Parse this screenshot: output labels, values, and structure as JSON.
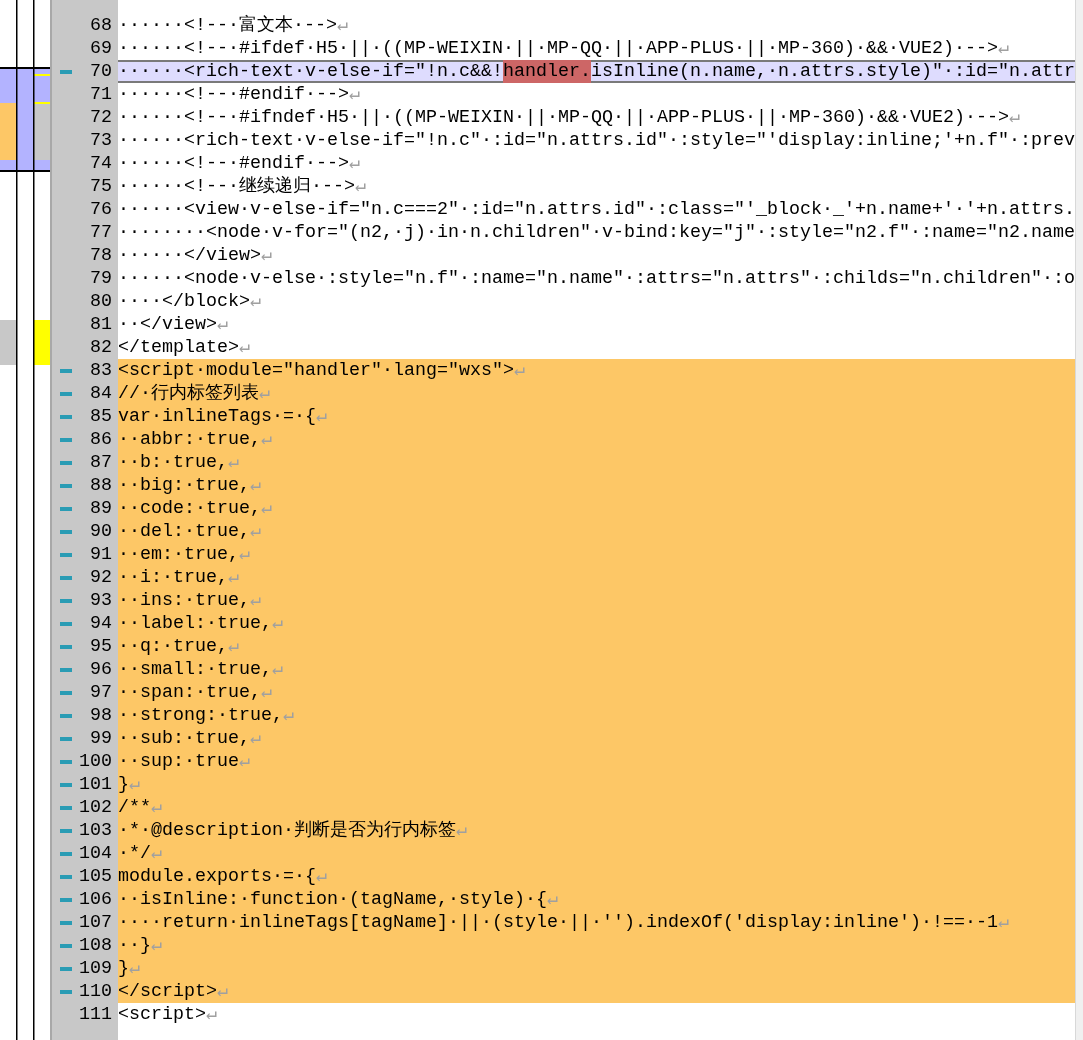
{
  "editor": {
    "lines": [
      {
        "number": "68",
        "text": "······<!--·富文本·-->",
        "eol": "↵",
        "changed": false,
        "current": false
      },
      {
        "number": "69",
        "text": "······<!--·#ifdef·H5·||·((MP-WEIXIN·||·MP-QQ·||·APP-PLUS·||·MP-360)·&&·VUE2)·-->",
        "eol": "↵",
        "changed": false,
        "current": false
      },
      {
        "number": "70",
        "segments": [
          {
            "text": "······<rich-text·v-else-if=\"!n.c&&!",
            "marked": false
          },
          {
            "text": "handler.",
            "marked": true
          },
          {
            "text": "isInline(n.name,·n.attrs.style)\"·:id=\"n.attr",
            "marked": false
          }
        ],
        "changed": true,
        "current": true
      },
      {
        "number": "71",
        "text": "······<!--·#endif·-->",
        "eol": "↵",
        "changed": false,
        "current": false
      },
      {
        "number": "72",
        "text": "······<!--·#ifndef·H5·||·((MP-WEIXIN·||·MP-QQ·||·APP-PLUS·||·MP-360)·&&·VUE2)·-->",
        "eol": "↵",
        "changed": false,
        "current": false
      },
      {
        "number": "73",
        "text": "······<rich-text·v-else-if=\"!n.c\"·:id=\"n.attrs.id\"·:style=\"'display:inline;'+n.f\"·:prev",
        "changed": false,
        "current": false
      },
      {
        "number": "74",
        "text": "······<!--·#endif·-->",
        "eol": "↵",
        "changed": false,
        "current": false
      },
      {
        "number": "75",
        "text": "······<!--·继续递归·-->",
        "eol": "↵",
        "changed": false,
        "current": false
      },
      {
        "number": "76",
        "text": "······<view·v-else-if=\"n.c===2\"·:id=\"n.attrs.id\"·:class=\"'_block·_'+n.name+'·'+n.attrs.",
        "changed": false,
        "current": false
      },
      {
        "number": "77",
        "text": "········<node·v-for=\"(n2,·j)·in·n.children\"·v-bind:key=\"j\"·:style=\"n2.f\"·:name=\"n2.name",
        "changed": false,
        "current": false
      },
      {
        "number": "78",
        "text": "······</view>",
        "eol": "↵",
        "changed": false,
        "current": false
      },
      {
        "number": "79",
        "text": "······<node·v-else·:style=\"n.f\"·:name=\"n.name\"·:attrs=\"n.attrs\"·:childs=\"n.children\"·:o",
        "changed": false,
        "current": false
      },
      {
        "number": "80",
        "text": "····</block>",
        "eol": "↵",
        "changed": false,
        "current": false
      },
      {
        "number": "81",
        "text": "··</view>",
        "eol": "↵",
        "changed": false,
        "current": false
      },
      {
        "number": "82",
        "text": "</template>",
        "eol": "↵",
        "changed": false,
        "current": false
      },
      {
        "number": "83",
        "text": "<script·module=\"handler\"·lang=\"wxs\">",
        "eol": "↵",
        "changed": true,
        "current": false
      },
      {
        "number": "84",
        "text": "//·行内标签列表",
        "eol": "↵",
        "changed": true,
        "current": false
      },
      {
        "number": "85",
        "text": "var·inlineTags·=·{",
        "eol": "↵",
        "changed": true,
        "current": false
      },
      {
        "number": "86",
        "text": "··abbr:·true,",
        "eol": "↵",
        "changed": true,
        "current": false
      },
      {
        "number": "87",
        "text": "··b:·true,",
        "eol": "↵",
        "changed": true,
        "current": false
      },
      {
        "number": "88",
        "text": "··big:·true,",
        "eol": "↵",
        "changed": true,
        "current": false
      },
      {
        "number": "89",
        "text": "··code:·true,",
        "eol": "↵",
        "changed": true,
        "current": false
      },
      {
        "number": "90",
        "text": "··del:·true,",
        "eol": "↵",
        "changed": true,
        "current": false
      },
      {
        "number": "91",
        "text": "··em:·true,",
        "eol": "↵",
        "changed": true,
        "current": false
      },
      {
        "number": "92",
        "text": "··i:·true,",
        "eol": "↵",
        "changed": true,
        "current": false
      },
      {
        "number": "93",
        "text": "··ins:·true,",
        "eol": "↵",
        "changed": true,
        "current": false
      },
      {
        "number": "94",
        "text": "··label:·true,",
        "eol": "↵",
        "changed": true,
        "current": false
      },
      {
        "number": "95",
        "text": "··q:·true,",
        "eol": "↵",
        "changed": true,
        "current": false
      },
      {
        "number": "96",
        "text": "··small:·true,",
        "eol": "↵",
        "changed": true,
        "current": false
      },
      {
        "number": "97",
        "text": "··span:·true,",
        "eol": "↵",
        "changed": true,
        "current": false
      },
      {
        "number": "98",
        "text": "··strong:·true,",
        "eol": "↵",
        "changed": true,
        "current": false
      },
      {
        "number": "99",
        "text": "··sub:·true,",
        "eol": "↵",
        "changed": true,
        "current": false
      },
      {
        "number": "100",
        "text": "··sup:·true",
        "eol": "↵",
        "changed": true,
        "current": false
      },
      {
        "number": "101",
        "text": "}",
        "eol": "↵",
        "changed": true,
        "current": false
      },
      {
        "number": "102",
        "text": "/**",
        "eol": "↵",
        "changed": true,
        "current": false
      },
      {
        "number": "103",
        "text": "·*·@description·判断是否为行内标签",
        "eol": "↵",
        "changed": true,
        "current": false
      },
      {
        "number": "104",
        "text": "·*/",
        "eol": "↵",
        "changed": true,
        "current": false
      },
      {
        "number": "105",
        "text": "module.exports·=·{",
        "eol": "↵",
        "changed": true,
        "current": false
      },
      {
        "number": "106",
        "text": "··isInline:·function·(tagName,·style)·{",
        "eol": "↵",
        "changed": true,
        "current": false
      },
      {
        "number": "107",
        "text": "····return·inlineTags[tagName]·||·(style·||·'').indexOf('display:inline')·!==·-1",
        "eol": "↵",
        "changed": true,
        "current": false
      },
      {
        "number": "108",
        "text": "··}",
        "eol": "↵",
        "changed": true,
        "current": false
      },
      {
        "number": "109",
        "text": "}",
        "eol": "↵",
        "changed": true,
        "current": false
      },
      {
        "number": "110",
        "text": "</script>",
        "eol": "↵",
        "changed": true,
        "current": false
      },
      {
        "number": "111",
        "text": "<script>",
        "eol": "↵",
        "changed": false,
        "current": false
      }
    ]
  }
}
